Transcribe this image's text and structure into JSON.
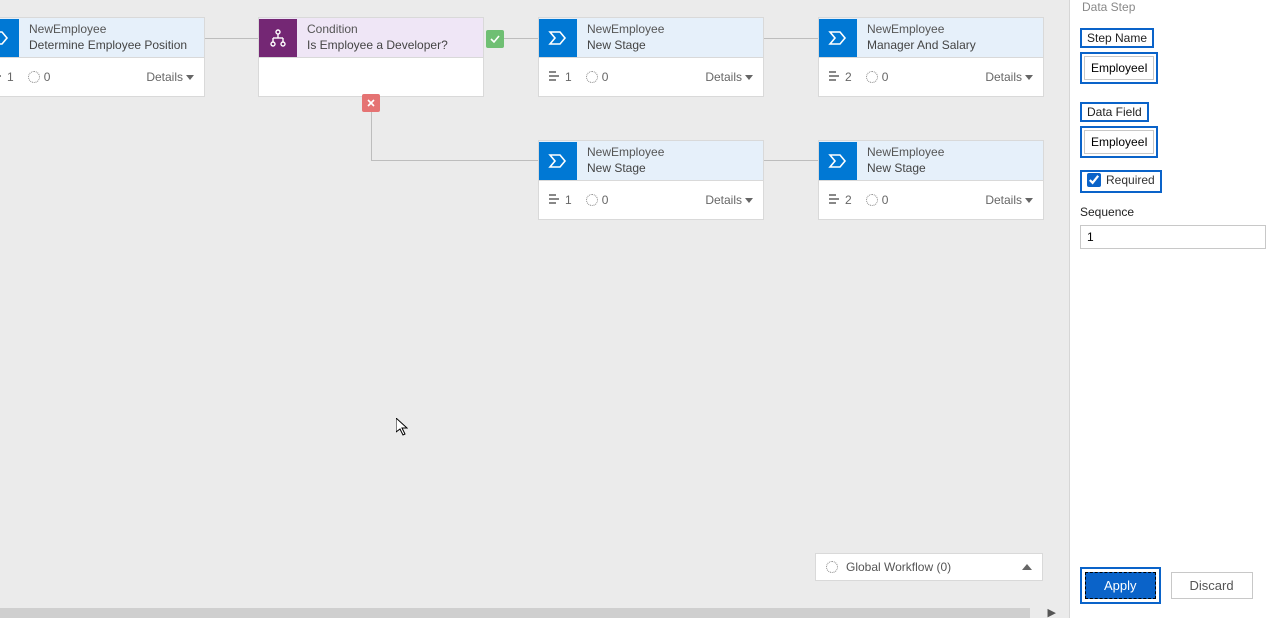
{
  "nodes": {
    "n1": {
      "title": "NewEmployee",
      "sub": "Determine Employee Position",
      "steps": "1",
      "count": "0",
      "details": "Details"
    },
    "cond": {
      "title": "Condition",
      "sub": "Is Employee a Developer?"
    },
    "n2": {
      "title": "NewEmployee",
      "sub": "New Stage",
      "steps": "1",
      "count": "0",
      "details": "Details"
    },
    "n3": {
      "title": "NewEmployee",
      "sub": "Manager And Salary",
      "steps": "2",
      "count": "0",
      "details": "Details"
    },
    "n4": {
      "title": "NewEmployee",
      "sub": "New Stage",
      "steps": "1",
      "count": "0",
      "details": "Details"
    },
    "n5": {
      "title": "NewEmployee",
      "sub": "New Stage",
      "steps": "2",
      "count": "0",
      "details": "Details"
    }
  },
  "globalWorkflow": {
    "label": "Global Workflow (0)"
  },
  "panel": {
    "dataStep": "Data Step",
    "stepNameLabel": "Step Name",
    "stepNameValue": "EmployeeID",
    "dataFieldLabel": "Data Field",
    "dataFieldValue": "EmployeeID",
    "requiredLabel": "Required",
    "requiredChecked": true,
    "sequenceLabel": "Sequence",
    "sequenceValue": "1",
    "apply": "Apply",
    "discard": "Discard"
  }
}
